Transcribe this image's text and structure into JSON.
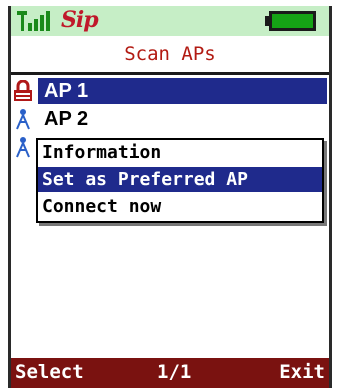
{
  "status": {
    "signal_icon": "signal-strength-icon",
    "sip_label": "Sip",
    "battery_icon": "battery-icon",
    "accent": "#c0182a",
    "bar_color": "#c6eec6"
  },
  "title": "Scan APs",
  "aps": [
    {
      "label": "AP 1",
      "icon": "lock-icon",
      "selected": true
    },
    {
      "label": "AP 2",
      "icon": "antenna-icon",
      "selected": false
    },
    {
      "label": "",
      "icon": "antenna-icon",
      "selected": false
    }
  ],
  "context_menu": {
    "items": [
      "Information",
      "Set as Preferred AP",
      "Connect now"
    ],
    "selected_index": 1
  },
  "softkeys": {
    "left": "Select",
    "middle": "1/1",
    "right": "Exit",
    "bar_color": "#7a1210"
  },
  "highlight_color": "#1f2a8c"
}
